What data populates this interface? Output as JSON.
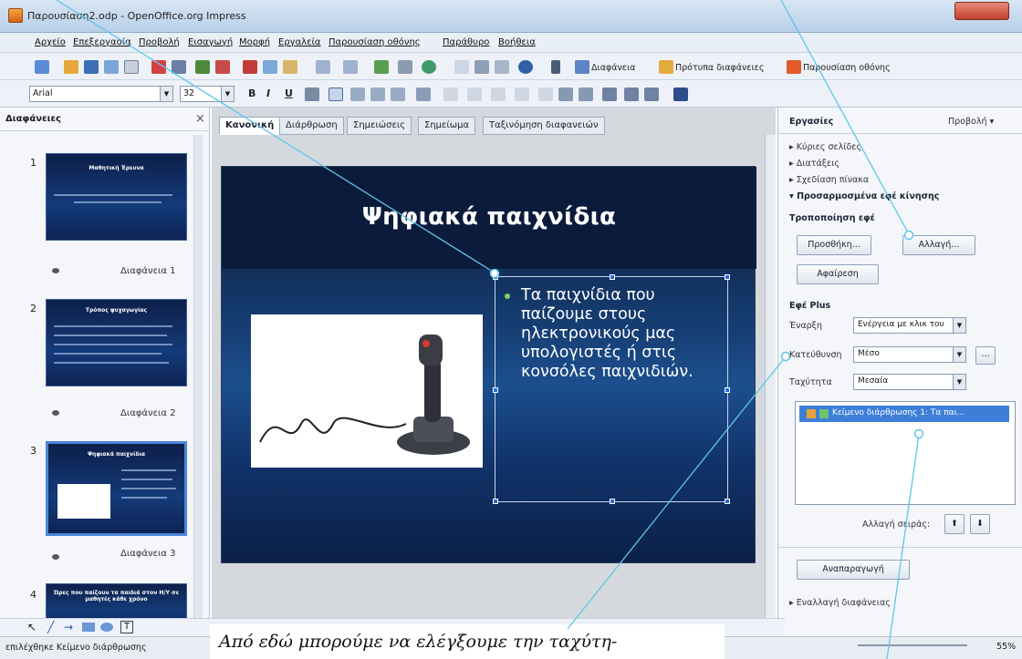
{
  "window": {
    "title": "Παρουσίαση2.odp - OpenOffice.org Impress"
  },
  "menu": [
    "Αρχείο",
    "Επεξεργασία",
    "Προβολή",
    "Εισαγωγή",
    "Μορφή",
    "Εργαλεία",
    "Παρουσίαση οθόνης",
    "Παράθυρο",
    "Βοήθεια"
  ],
  "toolbar": {
    "slide_label": "Διαφάνεια",
    "design_label": "Πρότυπα διαφάνειες",
    "show_label": "Παρουσίαση οθόνης"
  },
  "format": {
    "font": "Arial",
    "size": "32",
    "bold": "B",
    "italic": "I",
    "underline": "U"
  },
  "slides_panel": {
    "title": "Διαφάνειες",
    "close": "×",
    "slides": [
      {
        "num": "1",
        "title": "Μαθητική Έρευνα",
        "caption": "Διαφάνεια 1"
      },
      {
        "num": "2",
        "title": "Τρόπος ψυχαγωγίας",
        "caption": "Διαφάνεια 2"
      },
      {
        "num": "3",
        "title": "Ψηφιακά παιχνίδια",
        "caption": "Διαφάνεια 3"
      },
      {
        "num": "4",
        "title": "Ώρες που παίζουν τα παιδιά στον Η/Υ σε μαθητές κάθε χρόνο",
        "caption": ""
      }
    ]
  },
  "tabs": [
    "Κανονική",
    "Διάρθρωση",
    "Σημειώσεις",
    "Σημείωμα",
    "Ταξινόμηση διαφανειών"
  ],
  "slide": {
    "title": "Ψηφιακά παιχνίδια",
    "body": "Τα παιχνίδια που παίζουμε στους ηλεκτρονικούς μας υπολογιστές ή στις κονσόλες παιχνιδιών."
  },
  "tasks": {
    "title": "Εργασίες",
    "view": "Προβολή ▾",
    "sections": [
      "Κύριες σελίδες",
      "Διατάξεις",
      "Σχεδίαση πίνακα",
      "Προσαρμοσμένα εφέ κίνησης"
    ],
    "modify_title": "Τροποποίηση εφέ",
    "add_button": "Προσθήκη...",
    "change_button": "Αλλαγή...",
    "remove_button": "Αφαίρεση",
    "effect_title": "Εφέ Plus",
    "start_label": "Έναρξη",
    "start_value": "Ενέργεια με κλικ του",
    "direction_label": "Κατεύθυνση",
    "direction_value": "Μέσο",
    "speed_label": "Ταχύτητα",
    "speed_value": "Μεσαία",
    "effect_item": "Κείμενο διάρθρωσης 1: Τα παι...",
    "reorder_label": "Αλλαγή σειράς:",
    "play_button": "Αναπαραγωγή",
    "transition": "Εναλλαγή διαφάνειας"
  },
  "status": {
    "text": "επιλέχθηκε Κείμενο διάρθρωσης",
    "zoom": "55%"
  },
  "caption": "Από εδώ μπορούμε να ελέγξουμε την ταχύτη-"
}
